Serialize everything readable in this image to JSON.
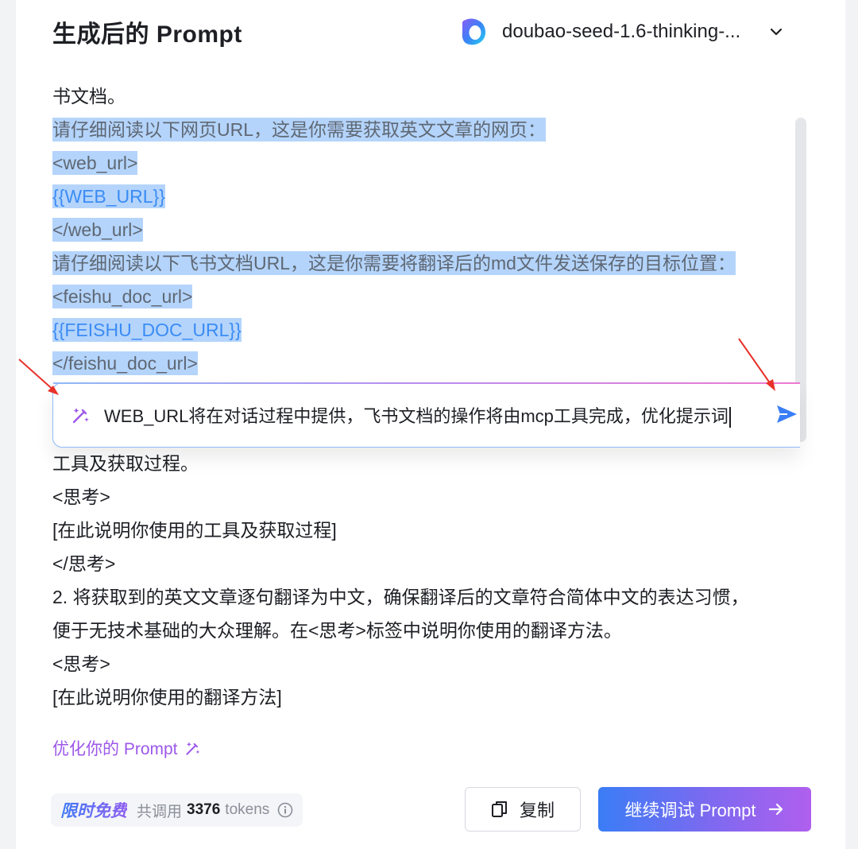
{
  "header": {
    "title": "生成后的 Prompt",
    "model_name": "doubao-seed-1.6-thinking-..."
  },
  "content": {
    "top_lines": [
      {
        "text": "书文档。",
        "style": "plain"
      },
      {
        "text": "请仔细阅读以下网页URL，这是你需要获取英文文章的网页：",
        "style": "highlight"
      },
      {
        "text": "<web_url>",
        "style": "highlight"
      },
      {
        "text": " {{WEB_URL}} ",
        "style": "highlight-var"
      },
      {
        "text": "</web_url>",
        "style": "highlight"
      },
      {
        "text": "请仔细阅读以下飞书文档URL，这是你需要将翻译后的md文件发送保存的目标位置：",
        "style": "highlight"
      },
      {
        "text": "<feishu_doc_url>",
        "style": "highlight"
      },
      {
        "text": " {{FEISHU_DOC_URL}} ",
        "style": "highlight-var"
      },
      {
        "text": "</feishu_doc_url>",
        "style": "highlight"
      }
    ],
    "bottom_lines": [
      "工具及获取过程。",
      "<思考>",
      "[在此说明你使用的工具及获取过程]",
      "</思考>",
      "2. 将获取到的英文文章逐句翻译为中文，确保翻译后的文章符合简体中文的表达习惯，",
      "便于无技术基础的大众理解。在<思考>标签中说明你使用的翻译方法。",
      "<思考>",
      "[在此说明你使用的翻译方法]"
    ]
  },
  "prompt_input": {
    "value": "WEB_URL将在对话过程中提供，飞书文档的操作将由mcp工具完成，优化提示词"
  },
  "optimize_link": "优化你的 Prompt",
  "footer": {
    "free_tag": "限时免费",
    "tokens_label": "共调用",
    "tokens_count": "3376",
    "tokens_unit": "tokens",
    "copy_label": "复制",
    "continue_label": "继续调试 Prompt"
  },
  "colors": {
    "highlight": "#b4d4fb",
    "variable_text": "#3b8cf5",
    "accent_purple": "#9d58e9",
    "arrow_red": "#e8312a",
    "button_gradient_start": "#3a7df6",
    "button_gradient_end": "#b05fee"
  }
}
